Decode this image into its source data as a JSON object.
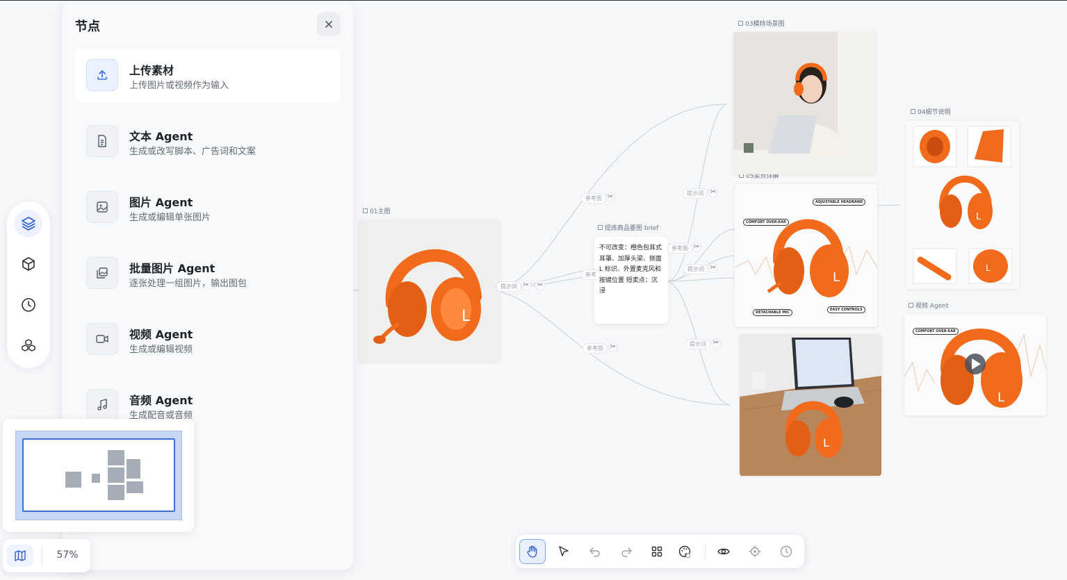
{
  "panel": {
    "title": "节点",
    "items": [
      {
        "title": "上传素材",
        "subtitle": "上传图片或视频作为输入",
        "icon": "upload-icon"
      },
      {
        "title": "文本 Agent",
        "subtitle": "生成或改写脚本、广告词和文案",
        "icon": "document-icon"
      },
      {
        "title": "图片 Agent",
        "subtitle": "生成或编辑单张图片",
        "icon": "image-icon"
      },
      {
        "title": "批量图片 Agent",
        "subtitle": "逐张处理一组图片，输出图包",
        "icon": "images-icon"
      },
      {
        "title": "视频 Agent",
        "subtitle": "生成或编辑视频",
        "icon": "video-icon"
      },
      {
        "title": "音频 Agent",
        "subtitle": "生成配音或音频",
        "icon": "music-icon"
      }
    ]
  },
  "rail": [
    "layers-icon",
    "cube-icon",
    "clock-icon",
    "blocks-icon"
  ],
  "zoom": "57%",
  "canvas": {
    "labels": {
      "main": "01主图",
      "scene": "03模特场景图",
      "detail": "04细节说明",
      "selling": "05卖点详解",
      "brief": "提炼商品要图 brief",
      "video": "视频 Agent"
    },
    "brief_text": "不可改变：橙色包耳式耳罩、加厚头梁、侧面 L 标识、外置麦克风和按键位置 短卖点：沉浸",
    "tags": {
      "ref1": "参考图",
      "ref2": "参考图",
      "ref3": "参考图",
      "ref4": "参考",
      "prompt1": "提示词",
      "prompt2": "提示词",
      "prompt3": "提示词",
      "prompt_main": "提示词"
    },
    "annotations": {
      "adjustable": "ADJUSTABLE HEADBAND",
      "comfort": "COMFORT OVER-EAR",
      "detachable": "DETACHABLE MIC",
      "easy": "EASY CONTROLS",
      "video_comfort": "COMFORT OVER-EAR"
    }
  },
  "toolbar": [
    "hand-icon",
    "pointer-icon",
    "undo-icon",
    "redo-icon",
    "grid-icon",
    "palette-icon",
    "eye-icon",
    "locate-icon",
    "history-icon"
  ],
  "colors": {
    "accent": "#3b6fd8",
    "product": "#f26a1b"
  }
}
